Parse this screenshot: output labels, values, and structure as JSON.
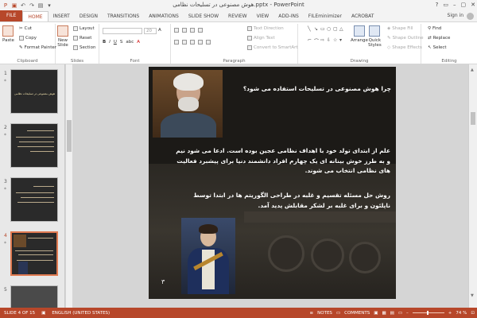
{
  "window": {
    "title": "هوش مصنوعی در تسلیحات نظامی.pptx - PowerPoint",
    "controls": [
      "?",
      "▭",
      "–",
      "▢",
      "✕"
    ]
  },
  "quick_access": [
    "save-icon",
    "undo-icon",
    "redo-icon",
    "start-from-beginning-icon",
    "customize-icon"
  ],
  "tabs": [
    "FILE",
    "HOME",
    "INSERT",
    "DESIGN",
    "TRANSITIONS",
    "ANIMATIONS",
    "SLIDE SHOW",
    "REVIEW",
    "VIEW",
    "ADD-INS",
    "FILEminimizer",
    "ACROBAT"
  ],
  "active_tab": "HOME",
  "account": {
    "signin": "Sign in"
  },
  "ribbon": {
    "clipboard": {
      "label": "Clipboard",
      "paste": "Paste",
      "cut": "Cut",
      "copy": "Copy",
      "format_painter": "Format Painter"
    },
    "slides": {
      "label": "Slides",
      "new_slide_line1": "New",
      "new_slide_line2": "Slide",
      "layout": "Layout",
      "reset": "Reset",
      "section": "Section"
    },
    "font": {
      "label": "Font",
      "size": "20"
    },
    "paragraph": {
      "label": "Paragraph",
      "text_direction": "Text Direction",
      "align_text": "Align Text",
      "smartart": "Convert to SmartArt"
    },
    "drawing": {
      "label": "Drawing",
      "arrange": "Arrange",
      "quick_styles_line1": "Quick",
      "quick_styles_line2": "Styles",
      "shape_fill": "Shape Fill",
      "shape_outline": "Shape Outline",
      "shape_effects": "Shape Effects"
    },
    "editing": {
      "label": "Editing",
      "find": "Find",
      "replace": "Replace",
      "select": "Select"
    }
  },
  "thumbnails": [
    {
      "num": "1",
      "star": "*",
      "title": "هوش مصنوعی در تسلیحات نظامی"
    },
    {
      "num": "2",
      "star": "*",
      "title": ""
    },
    {
      "num": "3",
      "star": "*",
      "title": ""
    },
    {
      "num": "4",
      "star": "*",
      "title": ""
    },
    {
      "num": "5",
      "star": "",
      "title": ""
    }
  ],
  "slide": {
    "title": "چرا هوش مصنوعی در تسلیحات استفاده می شود؟",
    "paragraph1": "علم از ابتدای تولد خود با اهداف نظامی عجین بوده است. ادعا می شود نیم و به طرز خوش بینانه ای یک چهارم افراد دانشمند دنیا برای پیشبرد فعالیت های نظامی انتخاب می شوند.",
    "paragraph2": "روش حل مسئله تقسیم و غلبه در طراحی الگوریتم ها در ابتدا توسط ناپلئون و برای غلبه بر لشکر مقابلش پدید آمد.",
    "number": "۳"
  },
  "status": {
    "slide_of": "SLIDE 4 OF 15",
    "language": "ENGLISH (UNITED STATES)",
    "notes": "NOTES",
    "comments": "COMMENTS",
    "zoom": "74 %"
  },
  "colors": {
    "accent": "#b7472a",
    "slide_bg": "#1c1a17",
    "selection": "#e07a51"
  }
}
